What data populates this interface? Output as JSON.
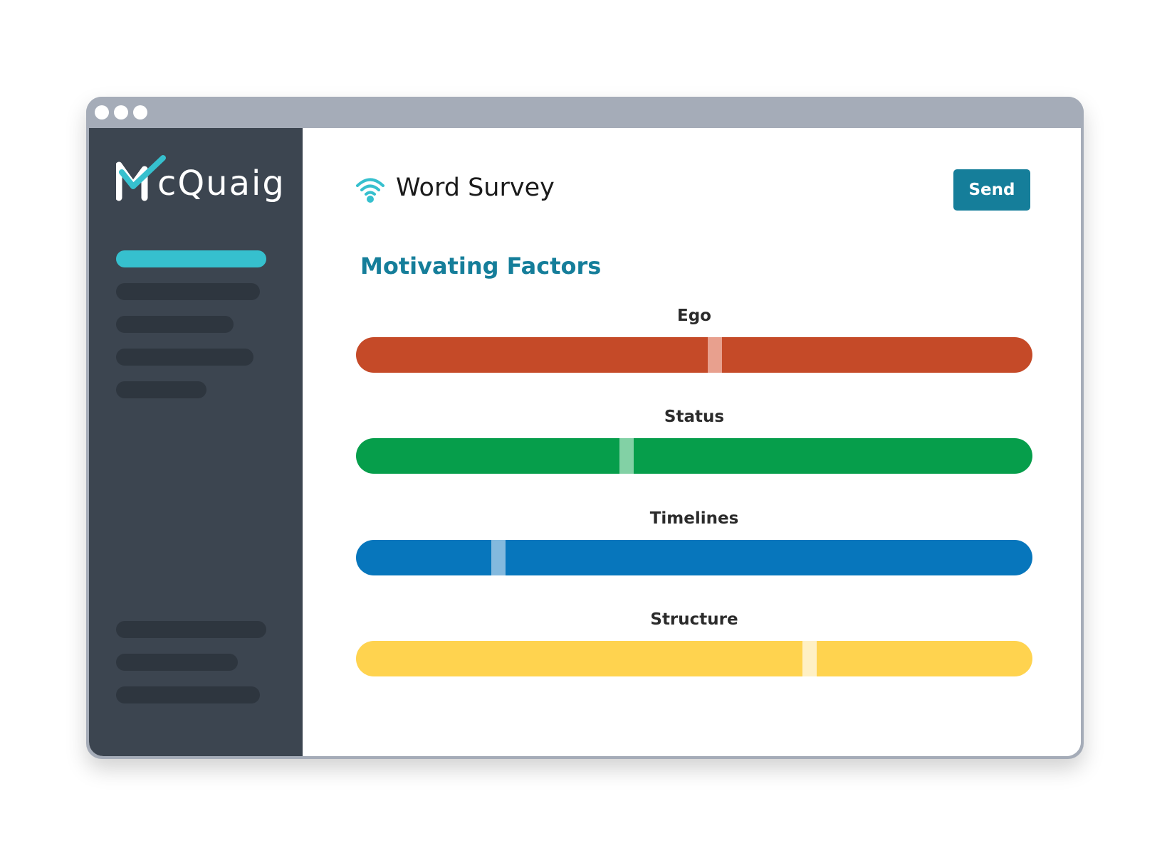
{
  "app": {
    "logo_text": "cQuaig",
    "logo_full": "McQuaig",
    "colors": {
      "accent": "#36c0ce",
      "primary": "#157e9a",
      "sidebar": "#3c4550"
    }
  },
  "header": {
    "title": "Word Survey",
    "icon": "survey-signal-icon",
    "send_label": "Send"
  },
  "section": {
    "title": "Motivating Factors"
  },
  "factors": [
    {
      "label": "Ego",
      "color": "#c54a28",
      "marker_color": "#e8a08e",
      "value": 0.53
    },
    {
      "label": "Status",
      "color": "#069e4b",
      "marker_color": "#82d1a5",
      "value": 0.4
    },
    {
      "label": "Timelines",
      "color": "#0776bc",
      "marker_color": "#83b9de",
      "value": 0.21
    },
    {
      "label": "Structure",
      "color": "#ffd34f",
      "marker_color": "#fff0c4",
      "value": 0.67
    }
  ]
}
